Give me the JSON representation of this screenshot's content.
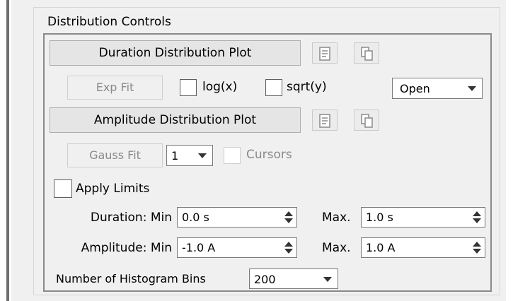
{
  "group_title": "Distribution Controls",
  "duration": {
    "plot_button": "Duration Distribution Plot",
    "fit_button": "Exp Fit",
    "log_label": "log(x)",
    "sqrt_label": "sqrt(y)",
    "dropdown_value": "Open"
  },
  "amplitude": {
    "plot_button": "Amplitude Distribution Plot",
    "fit_button": "Gauss Fit",
    "gauss_count": "1",
    "cursors_label": "Cursors"
  },
  "limits": {
    "apply_label": "Apply Limits",
    "duration_min_label": "Duration: Min",
    "duration_min_value": "0.0 s",
    "duration_max_label": "Max.",
    "duration_max_value": "1.0 s",
    "amplitude_min_label": "Amplitude: Min",
    "amplitude_min_value": "-1.0 A",
    "amplitude_max_label": "Max.",
    "amplitude_max_value": "1.0 A"
  },
  "bins": {
    "label": "Number of Histogram Bins",
    "value": "200"
  },
  "icons": [
    "list-icon",
    "copy-icon"
  ]
}
